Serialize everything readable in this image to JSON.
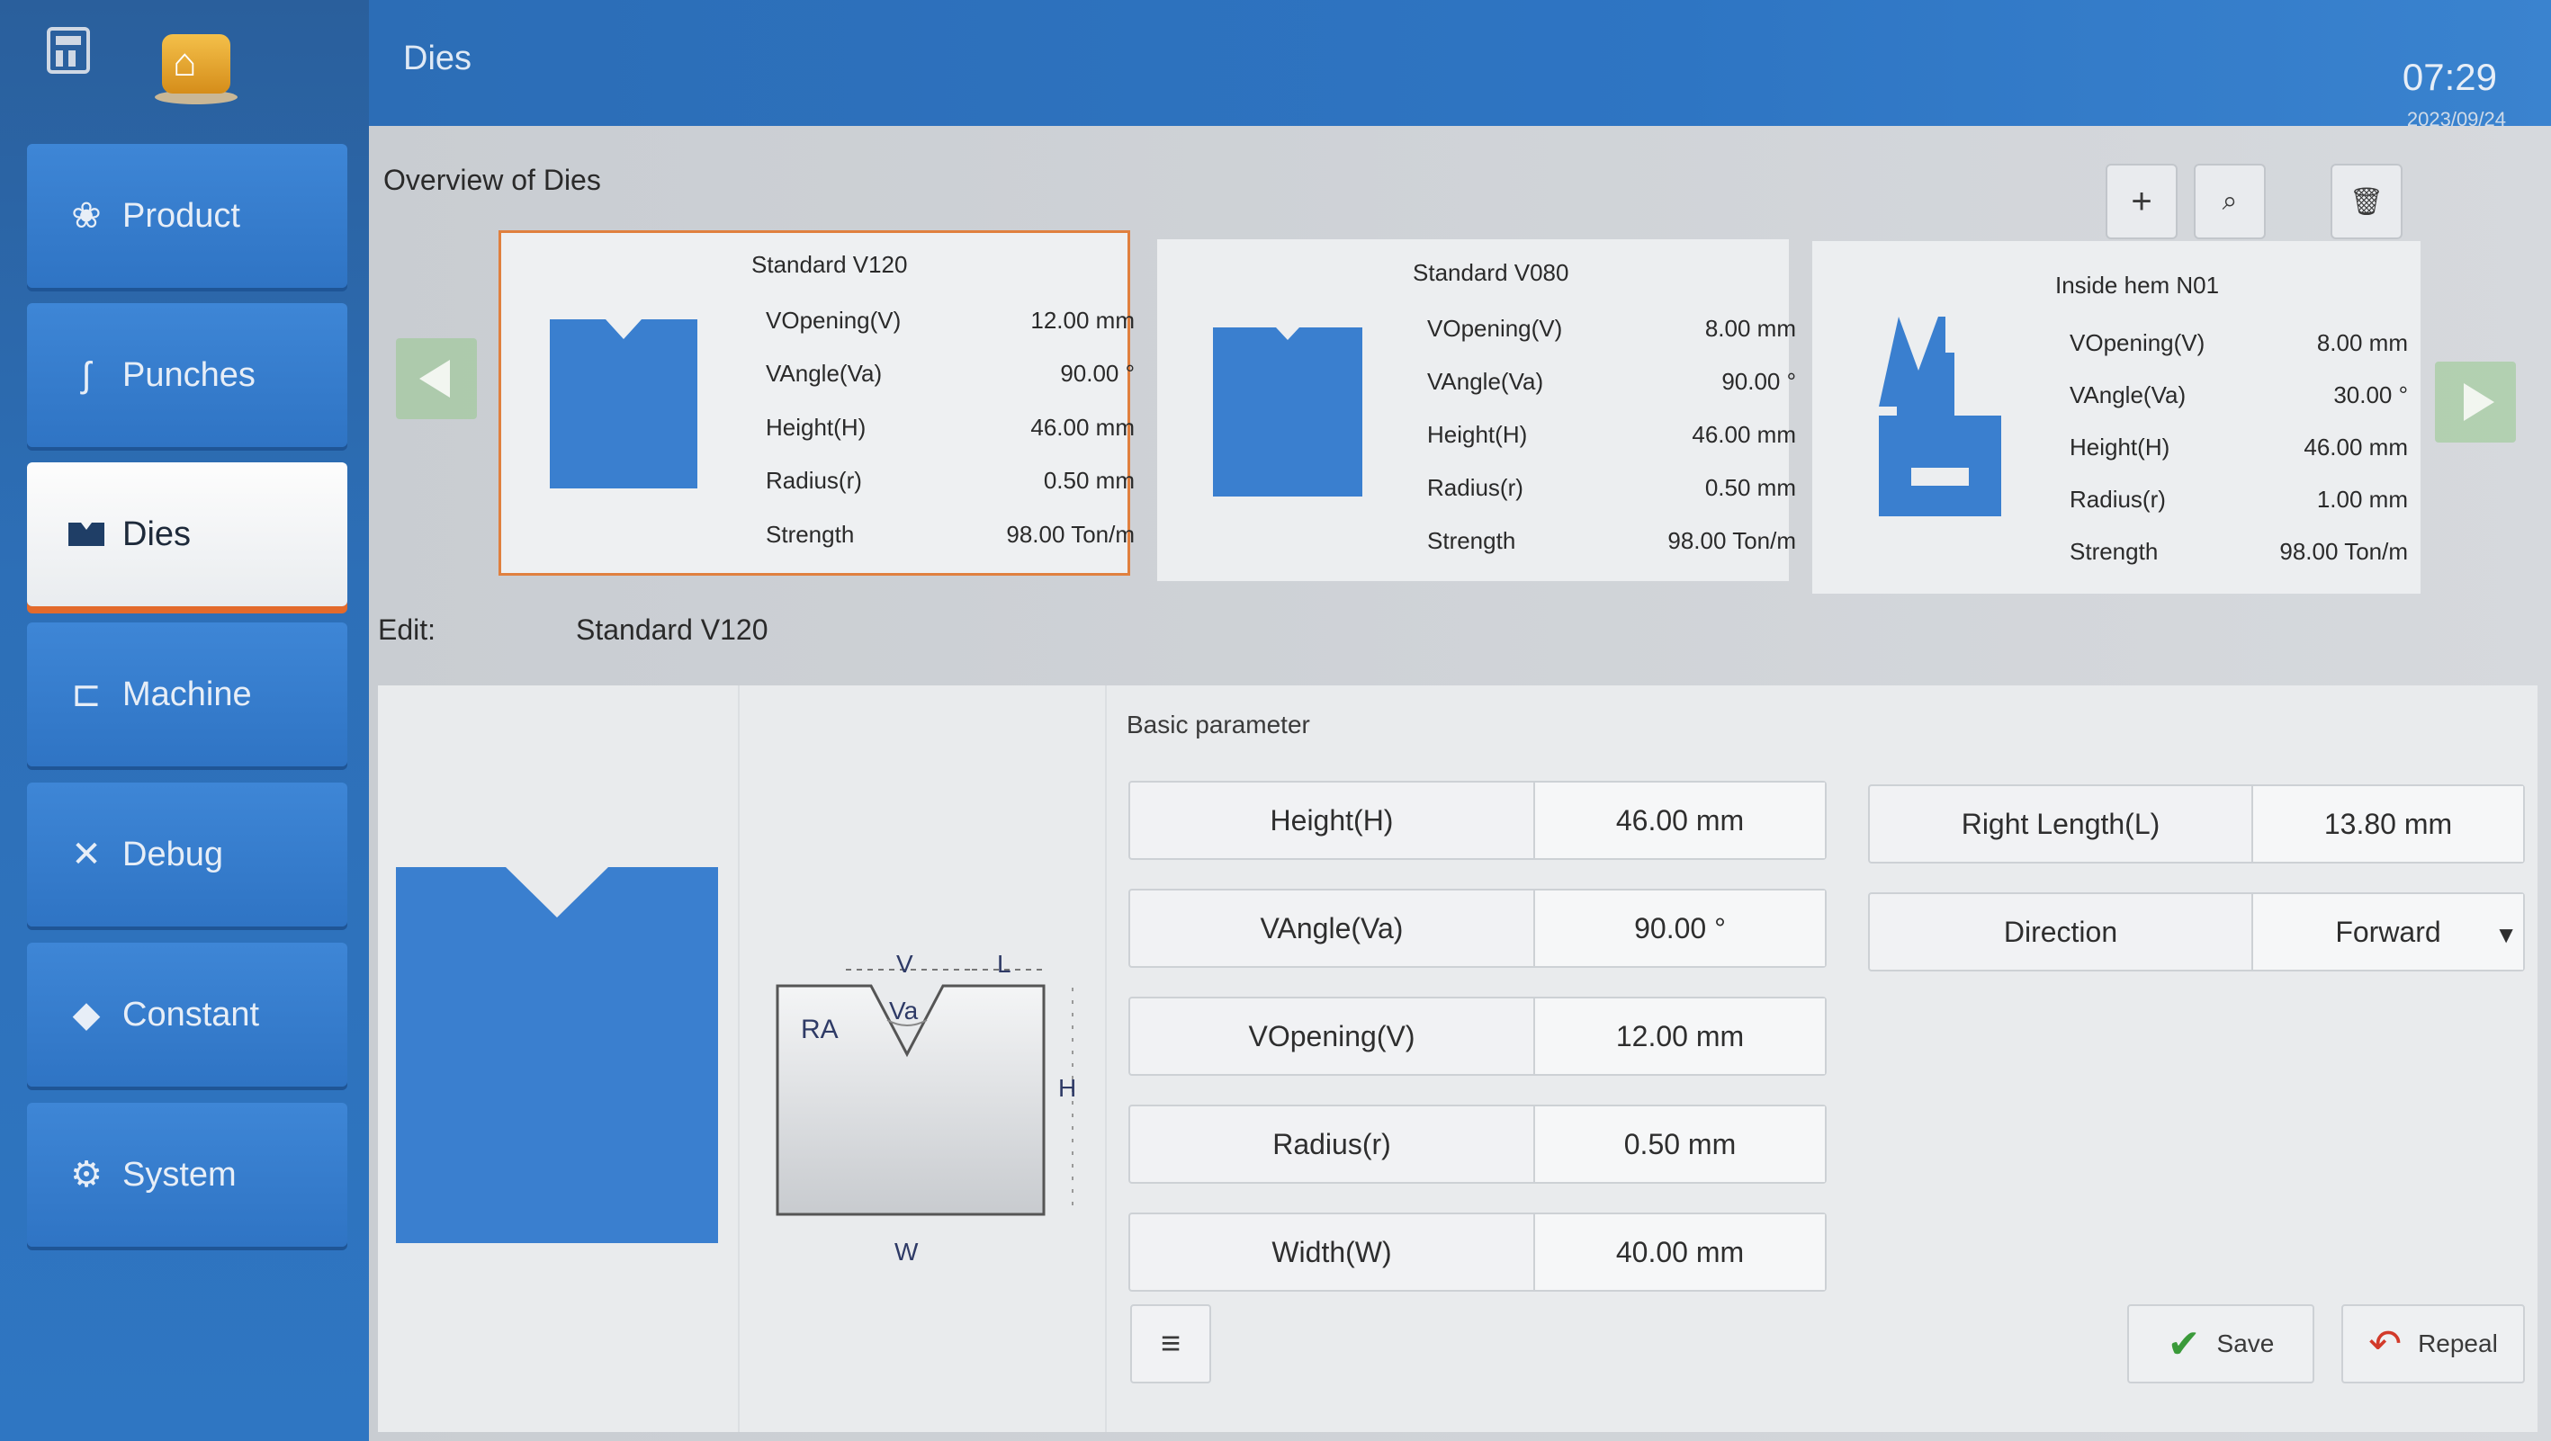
{
  "header": {
    "title": "Dies",
    "time": "07:29",
    "date": "2023/09/24"
  },
  "sidebar": {
    "items": [
      {
        "label": "Product",
        "icon": "product-icon",
        "active": false
      },
      {
        "label": "Punches",
        "icon": "punch-icon",
        "active": false
      },
      {
        "label": "Dies",
        "icon": "die-icon",
        "active": true
      },
      {
        "label": "Machine",
        "icon": "machine-icon",
        "active": false
      },
      {
        "label": "Debug",
        "icon": "wrench-icon",
        "active": false
      },
      {
        "label": "Constant",
        "icon": "diamond-icon",
        "active": false
      },
      {
        "label": "System",
        "icon": "gear-icon",
        "active": false
      }
    ]
  },
  "overview": {
    "title": "Overview of Dies",
    "toolbar": {
      "add": "+",
      "search": "⌕",
      "delete": "🗑"
    },
    "cards": [
      {
        "name": "Standard V120",
        "selected": true,
        "rows": [
          {
            "label": "VOpening(V)",
            "value": "12.00 mm"
          },
          {
            "label": "VAngle(Va)",
            "value": "90.00 °"
          },
          {
            "label": "Height(H)",
            "value": "46.00 mm"
          },
          {
            "label": "Radius(r)",
            "value": "0.50 mm"
          },
          {
            "label": "Strength",
            "value": "98.00 Ton/m"
          }
        ]
      },
      {
        "name": "Standard V080",
        "selected": false,
        "rows": [
          {
            "label": "VOpening(V)",
            "value": "8.00 mm"
          },
          {
            "label": "VAngle(Va)",
            "value": "90.00 °"
          },
          {
            "label": "Height(H)",
            "value": "46.00 mm"
          },
          {
            "label": "Radius(r)",
            "value": "0.50 mm"
          },
          {
            "label": "Strength",
            "value": "98.00 Ton/m"
          }
        ]
      },
      {
        "name": "Inside hem N01",
        "selected": false,
        "rows": [
          {
            "label": "VOpening(V)",
            "value": "8.00 mm"
          },
          {
            "label": "VAngle(Va)",
            "value": "30.00 °"
          },
          {
            "label": "Height(H)",
            "value": "46.00 mm"
          },
          {
            "label": "Radius(r)",
            "value": "1.00 mm"
          },
          {
            "label": "Strength",
            "value": "98.00 Ton/m"
          }
        ]
      }
    ]
  },
  "edit": {
    "label": "Edit:",
    "name": "Standard V120",
    "diagram_labels": {
      "v": "V",
      "l": "L",
      "va": "Va",
      "ra": "RA",
      "h": "H",
      "w": "W"
    },
    "basic_title": "Basic parameter",
    "params_left": [
      {
        "label": "Height(H)",
        "value": "46.00 mm"
      },
      {
        "label": "VAngle(Va)",
        "value": "90.00 °"
      },
      {
        "label": "VOpening(V)",
        "value": "12.00 mm"
      },
      {
        "label": "Radius(r)",
        "value": "0.50 mm"
      },
      {
        "label": "Width(W)",
        "value": "40.00 mm"
      }
    ],
    "params_right": [
      {
        "label": "Right Length(L)",
        "value": "13.80 mm"
      },
      {
        "label": "Direction",
        "value": "Forward"
      }
    ],
    "menu_symbol": "≡",
    "save_label": "Save",
    "repeal_label": "Repeal"
  },
  "colors": {
    "accent_blue": "#3b7fd0",
    "die_blue": "#3a7fcf",
    "selected_border": "#e0803f",
    "save_check": "#3a9a3a",
    "repeal_icon": "#d23a2a"
  }
}
